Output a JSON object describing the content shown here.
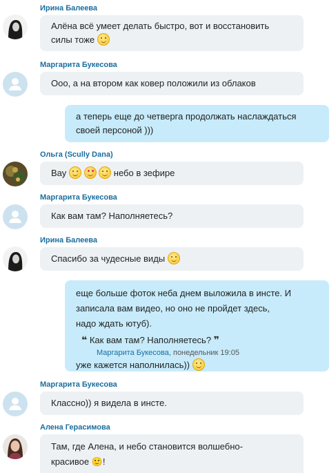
{
  "messages": {
    "m1": {
      "sender": "Ирина Балеева",
      "line1": "Алёна всё умеет делать быстро, вот и восстановить",
      "line2": "силы тоже"
    },
    "m2": {
      "sender": "Маргарита Букесова",
      "line1": "Ооо, а на втором как ковер положили из облаков"
    },
    "m3": {
      "line1": "а теперь еще до четверга продолжать наслаждаться",
      "line2": "своей персоной )))"
    },
    "m4": {
      "sender": "Ольга (Scully Dana)",
      "prefix": "Вау",
      "suffix": "небо в зефире"
    },
    "m5": {
      "sender": "Маргарита Букесова",
      "line1": "Как вам там? Наполняетесь?"
    },
    "m6": {
      "sender": "Ирина Балеева",
      "line1": "Спасибо за чудесные виды"
    },
    "m7": {
      "line1": "еще больше фоток неба днем выложила в инсте. И",
      "line2": "записала вам видео, но оно не пройдет здесь,",
      "line3": "надо ждать ютуб).",
      "quote": {
        "open_mark": "❝",
        "close_mark": "❞",
        "text": "Как вам там? Наполняетесь?",
        "author": "Маргарита Букесова",
        "time": ", понедельник 19:05"
      },
      "after": "уже кажется наполнилась))"
    },
    "m8": {
      "sender": "Маргарита Букесова",
      "line1": "Классно)) я видела в инсте."
    },
    "m9": {
      "sender": "Алена Герасимова",
      "line1": "Там, где Алена, и небо становится  волшебно-",
      "line2": "красивое 🙂!"
    }
  },
  "icons": {
    "emoji": "smile-emoji",
    "emoji_love": "heart-eyes-emoji",
    "avatar_default": "default-avatar-icon"
  },
  "colors": {
    "name": "#1a6e9e",
    "incoming_bubble": "#edf1f4",
    "outgoing_bubble": "#c7ebfb",
    "default_avatar": "#cde2ef"
  }
}
